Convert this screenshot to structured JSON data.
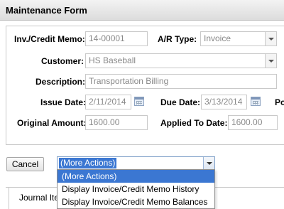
{
  "window": {
    "title": "Maintenance Form"
  },
  "form": {
    "inv_credit_memo": {
      "label": "Inv./Credit Memo:",
      "value": "14-00001"
    },
    "ar_type": {
      "label": "A/R Type:",
      "value": "Invoice"
    },
    "customer": {
      "label": "Customer:",
      "value": "HS Baseball"
    },
    "description": {
      "label": "Description:",
      "value": "Transportation Billing"
    },
    "issue_date": {
      "label": "Issue Date:",
      "value": "2/11/2014"
    },
    "due_date": {
      "label": "Due Date:",
      "value": "3/13/2014"
    },
    "truncated_label": "Po",
    "original_amount": {
      "label": "Original Amount:",
      "value": "1600.00"
    },
    "applied_to_date": {
      "label": "Applied To Date:",
      "value": "1600.00"
    }
  },
  "toolbar": {
    "cancel_label": "Cancel",
    "more_actions_selected": "(More Actions)",
    "more_actions_options": [
      "(More Actions)",
      "Display Invoice/Credit Memo History",
      "Display Invoice/Credit Memo Balances"
    ]
  },
  "tabs": [
    {
      "label": "Journal Ite"
    }
  ],
  "icons": {
    "calendar": "calendar-icon",
    "dropdown": "chevron-down-icon"
  },
  "colors": {
    "selection": "#3b77d2",
    "field_border": "#c9c9c9",
    "field_text": "#888888"
  }
}
